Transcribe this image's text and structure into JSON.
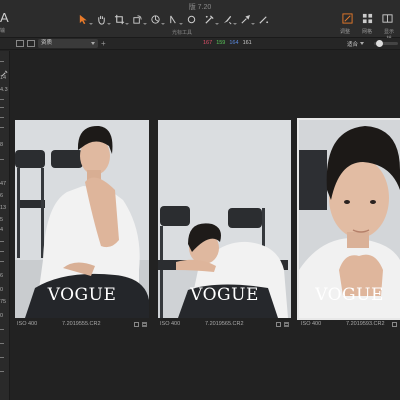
{
  "window": {
    "title": "版 7.20"
  },
  "toolbar": {
    "left_logo": "A",
    "left_label": "输",
    "tools_label": "光标工具",
    "tools": [
      {
        "icon": "pointer-icon"
      },
      {
        "icon": "pan-icon"
      },
      {
        "icon": "crop-icon"
      },
      {
        "icon": "rotate-icon"
      },
      {
        "icon": "keystone-icon"
      },
      {
        "icon": "spot-icon"
      },
      {
        "icon": "picker-icon"
      },
      {
        "icon": "brush-icon"
      },
      {
        "icon": "eyedropper-icon"
      },
      {
        "icon": "annotation-icon"
      }
    ],
    "right_tools": [
      {
        "icon": "adjust-icon",
        "label": "调整"
      },
      {
        "icon": "grid-icon",
        "label": "网格"
      },
      {
        "icon": "compare-icon",
        "label": "显示辅"
      }
    ],
    "accent": "#e87a2a"
  },
  "secondary_bar": {
    "dropdown_value": "资质",
    "stats": [
      {
        "value": "167",
        "color": "#e0506a"
      },
      {
        "value": "159",
        "color": "#5ac85a"
      },
      {
        "value": "164",
        "color": "#5a8ae0"
      },
      {
        "value": "161",
        "color": "#cccccc"
      }
    ],
    "fit_label": "适合"
  },
  "left_panel": {
    "values": [
      "14",
      "4.3",
      "8",
      "47",
      "6",
      "13",
      "5",
      "4",
      "6",
      "0",
      "75",
      "0"
    ]
  },
  "thumbnails": [
    {
      "iso": "ISO 400",
      "filename": "7.2019555.CR2",
      "brand": "VOGUE",
      "selected": false
    },
    {
      "iso": "ISO 400",
      "filename": "7.2019565.CR2",
      "brand": "VOGUE",
      "selected": false
    },
    {
      "iso": "ISO 400",
      "filename": "7.2019593.CR2",
      "brand": "VOGUE",
      "selected": true
    }
  ]
}
